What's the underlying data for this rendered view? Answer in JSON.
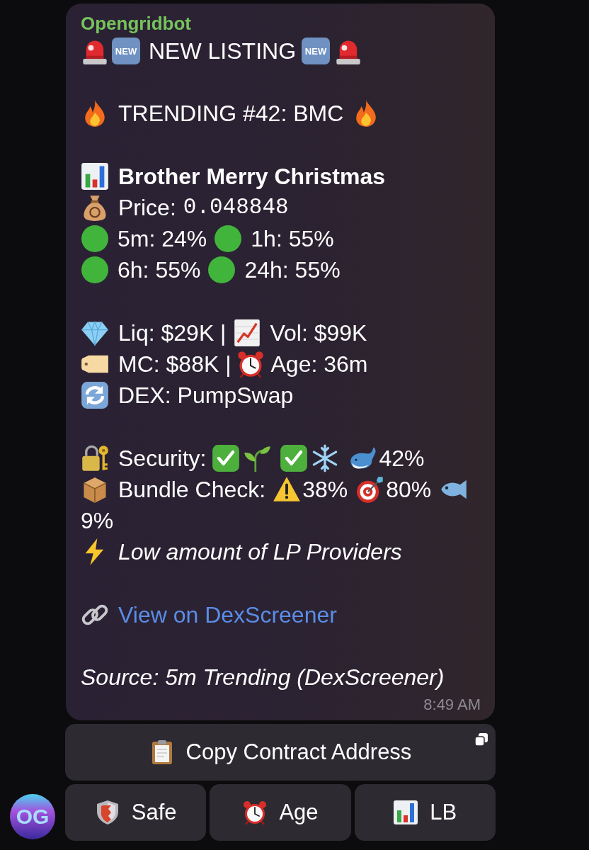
{
  "chat": {
    "avatar": {
      "initials": "OG"
    }
  },
  "message": {
    "sender": "Opengridbot",
    "headline": {
      "badge_left": "NEW",
      "title": "NEW LISTING",
      "badge_right": "NEW"
    },
    "trending": "TRENDING #42: BMC",
    "token_name": "Brother Merry Christmas",
    "price": {
      "label": "Price:",
      "value": "0.048848"
    },
    "changes": [
      {
        "text": "5m: 24%",
        "color": "#41b43c"
      },
      {
        "text": "1h: 55%",
        "color": "#41b43c"
      },
      {
        "text": "6h: 55%",
        "color": "#41b43c"
      },
      {
        "text": "24h: 55%",
        "color": "#41b43c"
      }
    ],
    "liquidity": "Liq: $29K |",
    "volume": "Vol: $99K",
    "market_cap": "MC: $88K |",
    "age": "Age: 36m",
    "dex": "DEX: PumpSwap",
    "security": {
      "label": "Security:",
      "checks": [
        {
          "passed": true
        },
        {
          "passed": true
        }
      ],
      "whale_share": "42%"
    },
    "bundle_check": {
      "label": "Bundle Check:",
      "warning_share": "38%",
      "target_share": "80%",
      "fish_share": "9%"
    },
    "note": "Low amount of LP Providers",
    "link": "View on DexScreener",
    "source": "Source: 5m Trending (DexScreener)",
    "time": "8:49 AM"
  },
  "keyboard": [
    [
      {
        "label": "Copy Contract Address"
      }
    ],
    [
      {
        "label": "Safe"
      },
      {
        "label": "Age"
      },
      {
        "label": "LB"
      }
    ]
  ]
}
